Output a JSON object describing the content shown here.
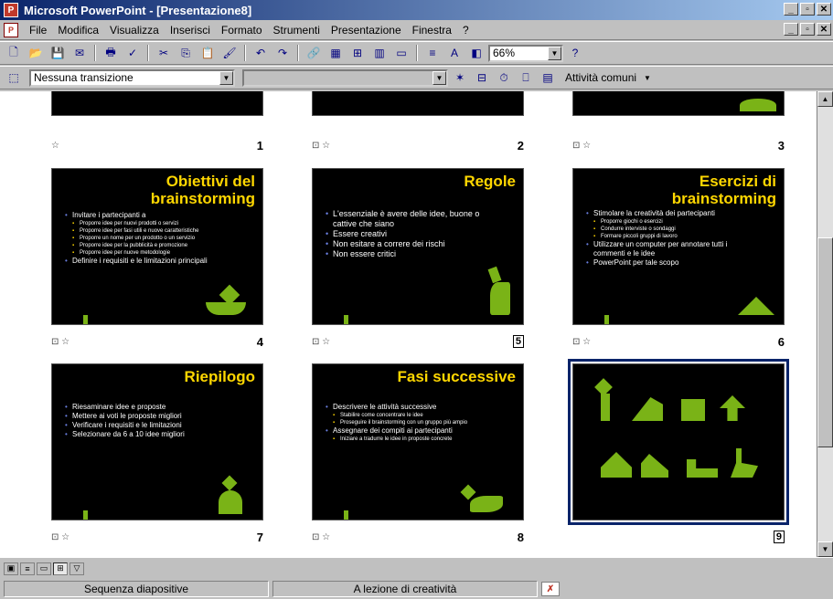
{
  "window": {
    "title": "Microsoft PowerPoint - [Presentazione8]",
    "minimize": "_",
    "maximize": "▫",
    "close": "✕"
  },
  "menu": {
    "items": [
      "File",
      "Modifica",
      "Visualizza",
      "Inserisci",
      "Formato",
      "Strumenti",
      "Presentazione",
      "Finestra",
      "?"
    ]
  },
  "toolbar": {
    "zoom": "66%",
    "transition": "Nessuna transizione",
    "common_tasks": "Attività comuni"
  },
  "slides": [
    {
      "number": "1",
      "title": "",
      "body": []
    },
    {
      "number": "2",
      "title": "",
      "body": []
    },
    {
      "number": "3",
      "title": "",
      "body": []
    },
    {
      "number": "4",
      "title": "Obiettivi del brainstorming",
      "body": [
        {
          "text": "Invitare i partecipanti a",
          "level": 1
        },
        {
          "text": "Proporre idee per nuovi prodotti o servizi",
          "level": 2
        },
        {
          "text": "Proporre idee per fasi utili e nuove caratteristiche",
          "level": 2
        },
        {
          "text": "Proporre un nome per un prodotto o un servizio",
          "level": 2
        },
        {
          "text": "Proporre idee per la pubblicità e promozione",
          "level": 2
        },
        {
          "text": "Proporre idee per nuove metodologie",
          "level": 2
        },
        {
          "text": "Definire i requisiti e le limitazioni principali",
          "level": 1
        }
      ]
    },
    {
      "number": "5",
      "title": "Regole",
      "body": [
        {
          "text": "L'essenziale è avere delle idee, buone o cattive che siano",
          "level": 1
        },
        {
          "text": "Essere creativi",
          "level": 1
        },
        {
          "text": "Non esitare a correre dei rischi",
          "level": 1
        },
        {
          "text": "Non essere critici",
          "level": 1
        }
      ]
    },
    {
      "number": "6",
      "title": "Esercizi di brainstorming",
      "body": [
        {
          "text": "Stimolare la creatività dei partecipanti",
          "level": 1
        },
        {
          "text": "Proporre giochi o esercizi",
          "level": 2
        },
        {
          "text": "Condurre interviste o sondaggi",
          "level": 2
        },
        {
          "text": "Formare piccoli gruppi di lavoro",
          "level": 2
        },
        {
          "text": "Utilizzare un computer per annotare tutti i commenti e le idee",
          "level": 1
        },
        {
          "text": "PowerPoint per tale scopo",
          "level": 1
        }
      ]
    },
    {
      "number": "7",
      "title": "Riepilogo",
      "body": [
        {
          "text": "Riesaminare idee e proposte",
          "level": 1
        },
        {
          "text": "Mettere ai voti le proposte migliori",
          "level": 1
        },
        {
          "text": "Verificare i requisiti e le limitazioni",
          "level": 1
        },
        {
          "text": "Selezionare da 6 a 10 idee migliori",
          "level": 1
        }
      ]
    },
    {
      "number": "8",
      "title": "Fasi successive",
      "body": [
        {
          "text": "Descrivere le attività successive",
          "level": 1
        },
        {
          "text": "Stabilire come concentrare le idee",
          "level": 2
        },
        {
          "text": "Proseguire il brainstorming con un gruppo più ampio",
          "level": 2
        },
        {
          "text": "Assegnare dei compiti ai partecipanti",
          "level": 1
        },
        {
          "text": "Iniziare a tradurre le idee in proposte concrete",
          "level": 2
        }
      ]
    },
    {
      "number": "9",
      "title": "",
      "body": []
    }
  ],
  "status": {
    "view": "Sequenza diapositive",
    "design": "A lezione di creatività"
  }
}
